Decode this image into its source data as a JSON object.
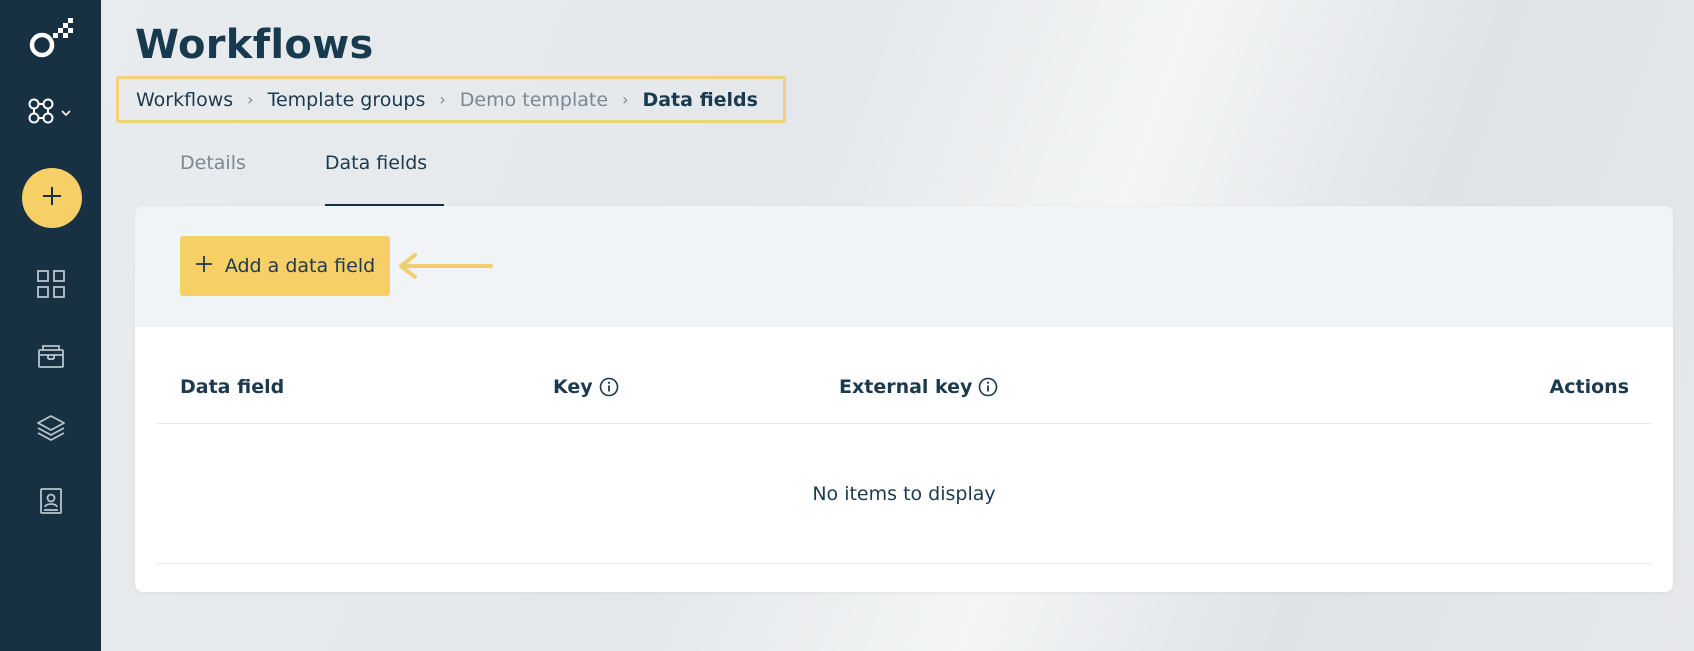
{
  "page": {
    "title": "Workflows"
  },
  "breadcrumb": [
    {
      "label": "Workflows"
    },
    {
      "label": "Template groups"
    },
    {
      "label": "Demo template"
    },
    {
      "label": "Data fields"
    }
  ],
  "tabs": [
    {
      "label": "Details"
    },
    {
      "label": "Data fields"
    }
  ],
  "toolbar": {
    "add_label": "Add a data field"
  },
  "table": {
    "columns": [
      "Data field",
      "Key",
      "External key",
      "Actions"
    ],
    "empty_text": "No items to display"
  },
  "sidebar": {
    "icons": [
      "logo-icon",
      "modules-icon",
      "plus-icon",
      "dashboard-icon",
      "folder-icon",
      "layers-icon",
      "contacts-icon"
    ]
  },
  "colors": {
    "sidebar": "#173042",
    "accent": "#f6cf66",
    "highlight_border": "#f0d27a",
    "text": "#1c3a4d",
    "muted": "#7a8893"
  }
}
